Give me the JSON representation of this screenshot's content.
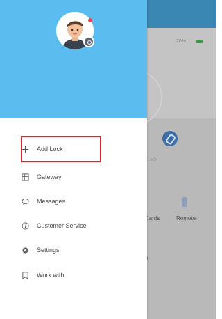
{
  "background": {
    "battery_text": "20%",
    "small_text": "Lock",
    "label_left": "Cards",
    "label_right": "Remote",
    "label_third": "n"
  },
  "drawer": {
    "avatar_name": "avatar",
    "menu": [
      {
        "label": "Add Lock",
        "icon": "plus-icon"
      },
      {
        "label": "Gateway",
        "icon": "gateway-icon"
      },
      {
        "label": "Messages",
        "icon": "message-icon"
      },
      {
        "label": "Customer Service",
        "icon": "info-icon"
      },
      {
        "label": "Settings",
        "icon": "gear-icon"
      },
      {
        "label": "Work with",
        "icon": "bookmark-icon"
      }
    ]
  },
  "colors": {
    "header_blue": "#5bbcef",
    "highlight_red": "#d7262f",
    "top_bar": "#3a87b3"
  }
}
